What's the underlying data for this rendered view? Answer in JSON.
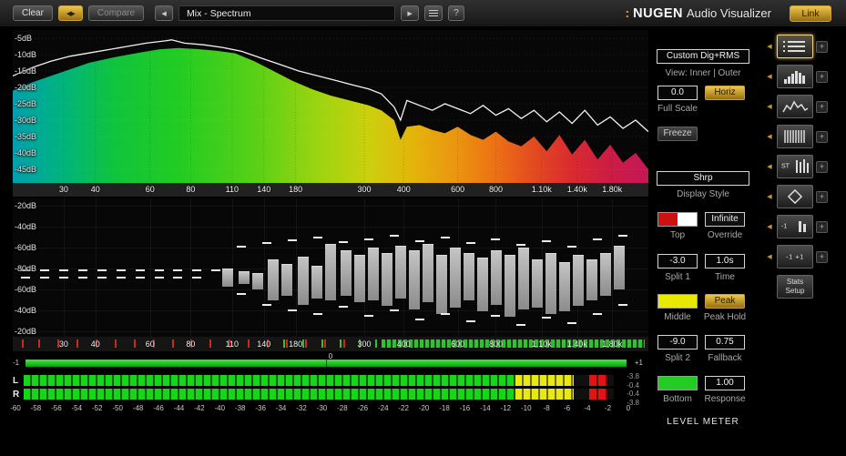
{
  "topbar": {
    "clear": "Clear",
    "swap": "◀▶",
    "compare": "Compare",
    "prev": "◀",
    "preset": "Mix - Spectrum",
    "play": "▶",
    "help": "?",
    "brand_dots": ":",
    "brand_name": "NUGEN",
    "brand_suffix": "Audio Visualizer",
    "link": "Link"
  },
  "spectrum": {
    "y_labels": [
      "-5dB",
      "-10dB",
      "-15dB",
      "-20dB",
      "-25dB",
      "-30dB",
      "-35dB",
      "-40dB",
      "-45dB"
    ],
    "freq_labels": [
      "30",
      "40",
      "60",
      "80",
      "110",
      "140",
      "180",
      "300",
      "400",
      "600",
      "800",
      "1.10k",
      "1.40k",
      "1.80k"
    ],
    "freq_pos_pct": [
      8,
      13,
      21.6,
      28,
      34.5,
      39.5,
      44.5,
      55.3,
      61.5,
      70,
      76,
      83.2,
      88.8,
      94.3
    ],
    "gradient_stops": [
      [
        0,
        "#00a0ae"
      ],
      [
        8,
        "#00b47c"
      ],
      [
        16,
        "#10c43c"
      ],
      [
        26,
        "#22cc22"
      ],
      [
        38,
        "#58d016"
      ],
      [
        48,
        "#9cd410"
      ],
      [
        56,
        "#ccd00c"
      ],
      [
        63,
        "#e4b40a"
      ],
      [
        70,
        "#eb9410"
      ],
      [
        76,
        "#ec7014"
      ],
      [
        82,
        "#e34a20"
      ],
      [
        88,
        "#d92a30"
      ],
      [
        94,
        "#cc1c44"
      ],
      [
        100,
        "#c41858"
      ]
    ],
    "fill_points": [
      [
        0,
        -21
      ],
      [
        3,
        -18.5
      ],
      [
        6,
        -16.5
      ],
      [
        9,
        -14.5
      ],
      [
        12,
        -12.5
      ],
      [
        16,
        -10.8
      ],
      [
        20,
        -9.4
      ],
      [
        23,
        -8.4
      ],
      [
        26,
        -8
      ],
      [
        29,
        -8.3
      ],
      [
        32,
        -8.8
      ],
      [
        35,
        -9.6
      ],
      [
        38,
        -12
      ],
      [
        41,
        -15
      ],
      [
        44,
        -18
      ],
      [
        47,
        -20.5
      ],
      [
        50,
        -22.5
      ],
      [
        53,
        -24
      ],
      [
        56,
        -25.5
      ],
      [
        58,
        -27
      ],
      [
        60,
        -30
      ],
      [
        61,
        -36
      ],
      [
        62,
        -32
      ],
      [
        64,
        -31.5
      ],
      [
        66,
        -33
      ],
      [
        68,
        -34
      ],
      [
        70,
        -32
      ],
      [
        72,
        -34.5
      ],
      [
        74,
        -36
      ],
      [
        76,
        -33.5
      ],
      [
        78,
        -36.5
      ],
      [
        80,
        -38
      ],
      [
        82,
        -35
      ],
      [
        84,
        -39.5
      ],
      [
        86,
        -34.5
      ],
      [
        88,
        -40.5
      ],
      [
        90,
        -36
      ],
      [
        92,
        -42
      ],
      [
        94,
        -37.5
      ],
      [
        96,
        -43
      ],
      [
        98,
        -40
      ],
      [
        100,
        -45
      ]
    ],
    "line_points": [
      [
        0,
        -16.5
      ],
      [
        3,
        -14
      ],
      [
        6,
        -12
      ],
      [
        9,
        -10.5
      ],
      [
        12,
        -9.5
      ],
      [
        15,
        -8.5
      ],
      [
        18,
        -7.5
      ],
      [
        21,
        -6.5
      ],
      [
        24,
        -5.8
      ],
      [
        25,
        -5.5
      ],
      [
        27,
        -6.5
      ],
      [
        30,
        -7
      ],
      [
        33,
        -7.8
      ],
      [
        36,
        -9
      ],
      [
        39,
        -11
      ],
      [
        42,
        -13
      ],
      [
        45,
        -15
      ],
      [
        48,
        -16.5
      ],
      [
        51,
        -18
      ],
      [
        54,
        -19.5
      ],
      [
        56,
        -20.5
      ],
      [
        58,
        -22
      ],
      [
        60,
        -26
      ],
      [
        61,
        -30
      ],
      [
        62,
        -24
      ],
      [
        64,
        -25.5
      ],
      [
        66,
        -27
      ],
      [
        68,
        -25
      ],
      [
        70,
        -26.5
      ],
      [
        72,
        -28
      ],
      [
        74,
        -25.5
      ],
      [
        76,
        -28.5
      ],
      [
        78,
        -26.5
      ],
      [
        80,
        -29.5
      ],
      [
        82,
        -27
      ],
      [
        84,
        -30.5
      ],
      [
        86,
        -27.5
      ],
      [
        88,
        -31
      ],
      [
        90,
        -27
      ],
      [
        92,
        -31.5
      ],
      [
        94,
        -29
      ],
      [
        96,
        -32.5
      ],
      [
        98,
        -30
      ],
      [
        100,
        -33.5
      ]
    ]
  },
  "mid": {
    "y_labels": [
      "-20dB",
      "-40dB",
      "-60dB",
      "-80dB",
      "-60dB",
      "-40dB",
      "-20dB"
    ],
    "bars": [
      [
        33.8,
        77,
        97
      ],
      [
        36.4,
        80,
        94
      ],
      [
        38.5,
        82,
        100
      ],
      [
        41,
        67,
        112
      ],
      [
        43.1,
        72,
        107
      ],
      [
        45.7,
        64,
        117
      ],
      [
        47.9,
        74,
        110
      ],
      [
        50,
        50,
        112
      ],
      [
        52.4,
        57,
        107
      ],
      [
        54.6,
        62,
        114
      ],
      [
        56.7,
        54,
        112
      ],
      [
        58.9,
        60,
        118
      ],
      [
        61,
        52,
        110
      ],
      [
        63.2,
        57,
        122
      ],
      [
        65.3,
        50,
        114
      ],
      [
        67.5,
        62,
        127
      ],
      [
        69.6,
        54,
        120
      ],
      [
        71.8,
        60,
        112
      ],
      [
        73.9,
        65,
        124
      ],
      [
        76.1,
        57,
        117
      ],
      [
        78.2,
        62,
        130
      ],
      [
        80.4,
        54,
        122
      ],
      [
        82.5,
        67,
        120
      ],
      [
        84.7,
        60,
        127
      ],
      [
        86.8,
        70,
        124
      ],
      [
        89,
        62,
        118
      ],
      [
        91.1,
        67,
        112
      ],
      [
        93.3,
        60,
        107
      ],
      [
        95.4,
        52,
        100
      ]
    ],
    "dashes": [
      [
        2,
        78
      ],
      [
        5,
        78
      ],
      [
        8,
        78
      ],
      [
        11,
        78
      ],
      [
        14,
        78
      ],
      [
        17,
        78
      ],
      [
        20,
        78
      ],
      [
        23,
        78
      ],
      [
        26,
        78
      ],
      [
        29,
        78
      ],
      [
        32,
        78
      ],
      [
        2,
        86
      ],
      [
        5,
        86
      ],
      [
        8,
        86
      ],
      [
        11,
        86
      ],
      [
        14,
        86
      ],
      [
        17,
        86
      ],
      [
        20,
        86
      ],
      [
        23,
        86
      ],
      [
        26,
        86
      ],
      [
        29,
        86
      ],
      [
        36,
        52
      ],
      [
        40,
        48
      ],
      [
        44,
        45
      ],
      [
        48,
        42
      ],
      [
        52,
        47
      ],
      [
        56,
        44
      ],
      [
        60,
        40
      ],
      [
        64,
        46
      ],
      [
        68,
        42
      ],
      [
        72,
        48
      ],
      [
        76,
        44
      ],
      [
        80,
        50
      ],
      [
        84,
        46
      ],
      [
        88,
        52
      ],
      [
        92,
        44
      ],
      [
        96,
        40
      ],
      [
        36,
        104
      ],
      [
        40,
        116
      ],
      [
        44,
        122
      ],
      [
        48,
        126
      ],
      [
        52,
        118
      ],
      [
        56,
        128
      ],
      [
        60,
        122
      ],
      [
        64,
        132
      ],
      [
        68,
        126
      ],
      [
        72,
        134
      ],
      [
        76,
        128
      ],
      [
        80,
        138
      ],
      [
        84,
        130
      ],
      [
        88,
        136
      ],
      [
        92,
        126
      ],
      [
        96,
        116
      ]
    ],
    "red_ticks_pct": [
      1.5,
      4,
      7,
      10,
      13,
      16,
      19,
      22,
      25,
      28,
      31,
      34,
      37,
      40,
      43,
      46,
      49,
      52
    ],
    "green_ticks_pct": [
      42.5,
      45.5,
      48.5,
      51.5,
      54.5,
      57
    ],
    "green_strip": [
      58,
      99.5
    ]
  },
  "correlation": {
    "left_label": "-1",
    "zero_label": "0",
    "right_label": "+1"
  },
  "meter": {
    "channels": [
      "L",
      "R"
    ],
    "values": [
      "-3.8",
      "-0.4",
      "-0.4",
      "-3.8"
    ],
    "scale_labels": [
      "-60",
      "-58",
      "-56",
      "-54",
      "-52",
      "-50",
      "-48",
      "-46",
      "-44",
      "-42",
      "-40",
      "-38",
      "-36",
      "-34",
      "-32",
      "-30",
      "-28",
      "-26",
      "-24",
      "-22",
      "-20",
      "-18",
      "-16",
      "-14",
      "-12",
      "-10",
      "-8",
      "-6",
      "-4",
      "-2",
      "0"
    ],
    "segments": {
      "green": [
        0,
        83.3
      ],
      "yellow": [
        83.3,
        93.2
      ],
      "red": [
        95.8,
        98.9
      ]
    }
  },
  "panel": {
    "mode": "Custom Dig+RMS",
    "view": "View: Inner | Outer",
    "full_scale_value": "0.0",
    "horiz": "Horiz",
    "full_scale": "Full Scale",
    "freeze": "Freeze",
    "style_value": "Shrp",
    "display_style": "Display Style",
    "infinite": "Infinite",
    "top": "Top",
    "override": "Override",
    "split1_value": "-3.0",
    "time_value": "1.0s",
    "split1": "Split 1",
    "time": "Time",
    "peak": "Peak",
    "middle": "Middle",
    "peak_hold": "Peak Hold",
    "split2_value": "-9.0",
    "fallback_value": "0.75",
    "split2": "Split 2",
    "fallback": "Fallback",
    "response_value": "1.00",
    "bottom": "Bottom",
    "response": "Response",
    "meter_title": "LEVEL METER",
    "swatch_colors": {
      "top_left": "#cc1111",
      "top_right": "#ffffff",
      "middle": "#e8e800",
      "bottom": "#22cc22"
    }
  },
  "rail": {
    "arrow": "◀",
    "plus": "+",
    "modules": [
      {
        "icon": "list-lines-icon",
        "label": "",
        "selected": true
      },
      {
        "icon": "histogram-icon",
        "label": "",
        "selected": false
      },
      {
        "icon": "spectrum-icon",
        "label": "",
        "selected": false
      },
      {
        "icon": "spectrogram-icon",
        "label": "",
        "selected": false
      },
      {
        "icon": "stereo-bars-icon",
        "label": "ST",
        "selected": false
      },
      {
        "icon": "vectorscope-icon",
        "label": "",
        "selected": false
      },
      {
        "icon": "mini-meter-icon",
        "label": "-1",
        "selected": false
      },
      {
        "icon": "correlation-icon",
        "label": "-1 +1",
        "selected": false
      }
    ],
    "stats_line1": "Stats",
    "stats_line2": "Setup"
  }
}
